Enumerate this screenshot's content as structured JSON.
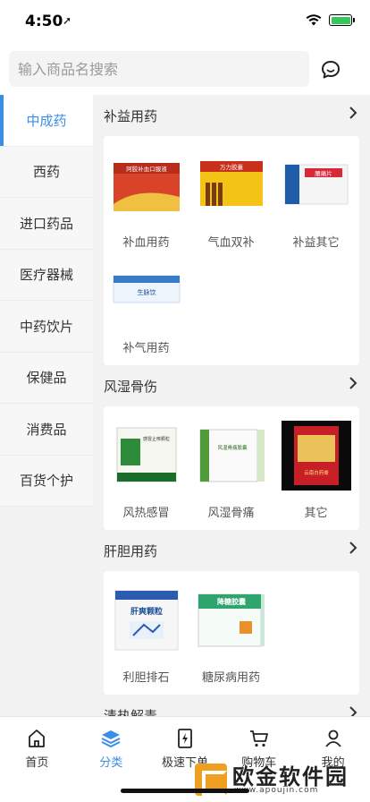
{
  "status": {
    "time": "4:50",
    "arrow": "➚"
  },
  "search": {
    "placeholder": "输入商品名搜索"
  },
  "sidebar": {
    "items": [
      {
        "label": "中成药",
        "active": true
      },
      {
        "label": "西药"
      },
      {
        "label": "进口药品"
      },
      {
        "label": "医疗器械"
      },
      {
        "label": "中药饮片"
      },
      {
        "label": "保健品"
      },
      {
        "label": "消费品"
      },
      {
        "label": "百货个护"
      }
    ]
  },
  "categories": [
    {
      "title": "补益用药",
      "products": [
        {
          "label": "补血用药",
          "box_text": "阿胶补血口服液"
        },
        {
          "label": "气血双补",
          "box_text": "万力胶囊"
        },
        {
          "label": "补益其它",
          "box_text": "腰痛片"
        },
        {
          "label": "补气用药",
          "box_text": "生脉饮"
        }
      ]
    },
    {
      "title": "风湿骨伤",
      "products": [
        {
          "label": "风热感冒",
          "box_text": "感冒止咳颗粒"
        },
        {
          "label": "风湿骨痛",
          "box_text": "风湿骨痛胶囊"
        },
        {
          "label": "其它",
          "box_text": "云南白药膏"
        }
      ]
    },
    {
      "title": "肝胆用药",
      "products": [
        {
          "label": "利胆排石",
          "box_text": "肝爽颗粒"
        },
        {
          "label": "糖尿病用药",
          "box_text": "降糖胶囊"
        }
      ]
    },
    {
      "title": "清热解毒",
      "products": []
    }
  ],
  "tabbar": {
    "items": [
      {
        "label": "首页"
      },
      {
        "label": "分类",
        "active": true
      },
      {
        "label": "极速下单"
      },
      {
        "label": "购物车"
      },
      {
        "label": "我的"
      }
    ]
  },
  "watermark": {
    "title": "欧金软件园",
    "url": "www.apoujin.com"
  },
  "colors": {
    "accent": "#3a8ee6",
    "background": "#f2f2f2"
  }
}
